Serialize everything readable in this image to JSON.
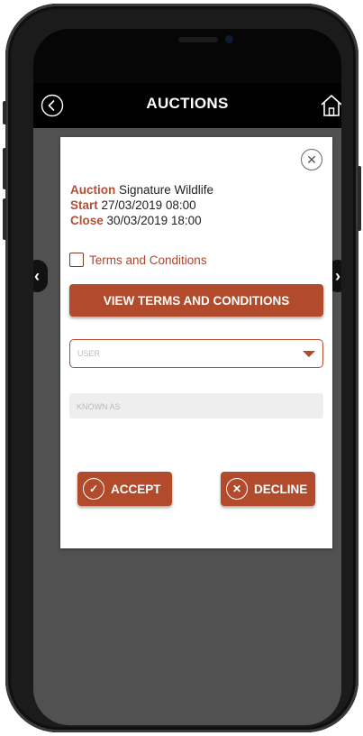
{
  "app_bar": {
    "title": "AUCTIONS",
    "back_icon": "back-circle-icon",
    "home_icon": "home-icon"
  },
  "carousel": {
    "prev_symbol": "‹",
    "next_symbol": "›"
  },
  "modal": {
    "close_symbol": "✕",
    "auction": {
      "label": "Auction",
      "value": "Signature Wildlife"
    },
    "start": {
      "label": "Start",
      "value": "27/03/2019 08:00"
    },
    "close": {
      "label": "Close",
      "value": "30/03/2019 18:00"
    },
    "terms_checkbox_label": "Terms and Conditions",
    "terms_checked": false,
    "view_terms_button": "VIEW TERMS AND CONDITIONS",
    "user_select": {
      "placeholder": "USER",
      "selected": ""
    },
    "known_as": {
      "placeholder": "KNOWN AS",
      "value": ""
    },
    "accept_button": "ACCEPT",
    "accept_symbol": "✓",
    "decline_button": "DECLINE",
    "decline_symbol": "✕"
  },
  "colors": {
    "accent": "#b24a2c",
    "backdrop": "#515151",
    "app_bar": "#000000"
  }
}
